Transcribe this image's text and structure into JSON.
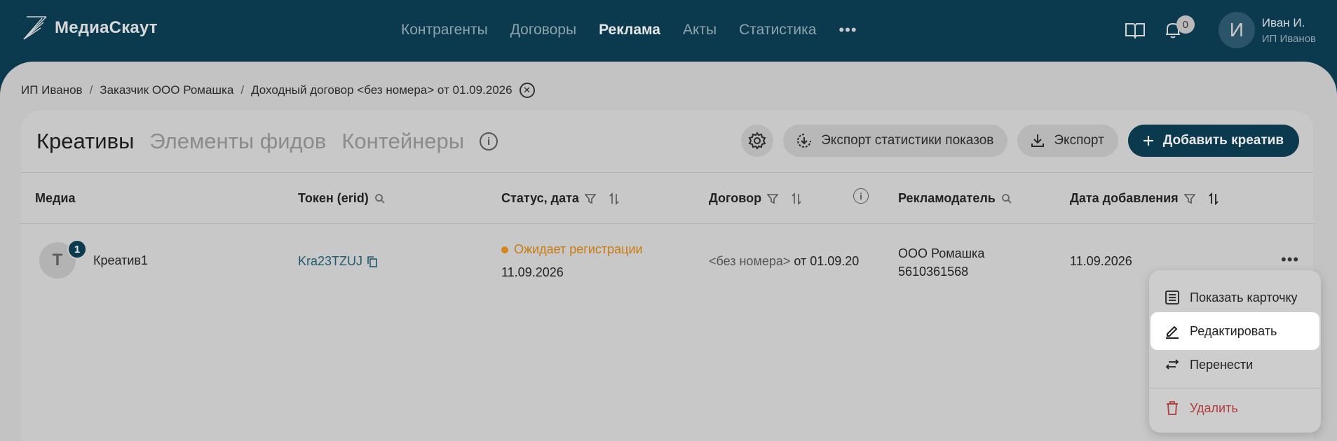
{
  "header": {
    "app_name": "МедиаСкаут",
    "nav": [
      {
        "label": "Контрагенты",
        "active": false
      },
      {
        "label": "Договоры",
        "active": false
      },
      {
        "label": "Реклама",
        "active": true
      },
      {
        "label": "Акты",
        "active": false
      },
      {
        "label": "Статистика",
        "active": false
      }
    ],
    "more": "•••",
    "notifications_count": "0",
    "avatar_letter": "И",
    "user_name": "Иван И.",
    "user_org": "ИП Иванов"
  },
  "breadcrumb": {
    "items": [
      "ИП Иванов",
      "Заказчик ООО Ромашка",
      "Доходный договор <без номера> от 01.09.2026"
    ],
    "separator": "/"
  },
  "tabs": [
    {
      "label": "Креативы",
      "active": true
    },
    {
      "label": "Элементы фидов",
      "active": false
    },
    {
      "label": "Контейнеры",
      "active": false
    }
  ],
  "toolbar": {
    "export_stats_label": "Экспорт статистики показов",
    "export_label": "Экспорт",
    "add_label": "Добавить креатив"
  },
  "table": {
    "columns": {
      "media": "Медиа",
      "token": "Токен (erid)",
      "status": "Статус, дата",
      "contract": "Договор",
      "advertiser": "Рекламодатель",
      "added": "Дата добавления"
    },
    "rows": [
      {
        "thumb_letter": "Т",
        "badge": "1",
        "name": "Креатив1",
        "token": "Kra23TZUJ",
        "status": "Ожидает регистрации",
        "status_date": "11.09.2026",
        "contract_num": "<без номера>",
        "contract_date": " от 01.09.20",
        "advertiser_name": "ООО Ромашка",
        "advertiser_inn": "5610361568",
        "added": "11.09.2026",
        "more": "•••"
      }
    ]
  },
  "context_menu": {
    "items": [
      {
        "label": "Показать карточку",
        "icon": "list-icon"
      },
      {
        "label": "Редактировать",
        "icon": "pencil-icon"
      },
      {
        "label": "Перенести",
        "icon": "swap-arrows-icon"
      },
      {
        "label": "Удалить",
        "icon": "trash-icon"
      }
    ]
  },
  "colors": {
    "brand": "#0b3a4f",
    "status_pending": "#d6851a",
    "danger": "#b33a3a"
  }
}
